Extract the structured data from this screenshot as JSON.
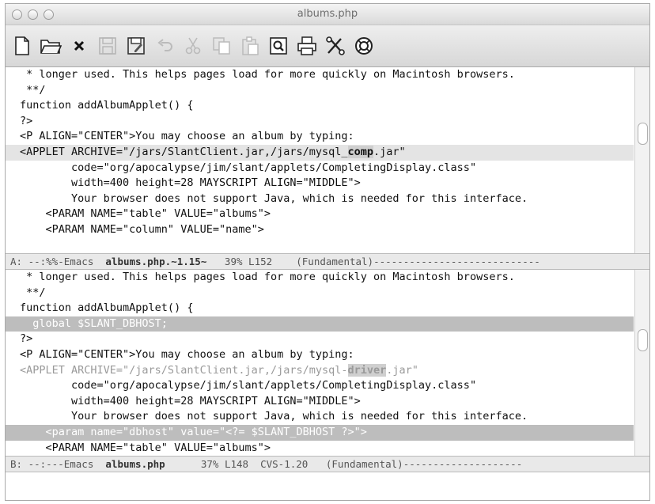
{
  "window": {
    "title": "albums.php"
  },
  "toolbar": {
    "items": [
      {
        "name": "new-file-button",
        "icon": "new-file-icon"
      },
      {
        "name": "open-folder-button",
        "icon": "folder-icon"
      },
      {
        "name": "close-buffer-button",
        "icon": "close-icon"
      },
      {
        "name": "save-button",
        "icon": "save-icon",
        "disabled": true
      },
      {
        "name": "save-as-button",
        "icon": "save-as-icon"
      },
      {
        "name": "undo-button",
        "icon": "undo-icon",
        "disabled": true
      },
      {
        "name": "cut-button",
        "icon": "cut-icon",
        "disabled": true
      },
      {
        "name": "copy-button",
        "icon": "copy-icon",
        "disabled": true
      },
      {
        "name": "paste-button",
        "icon": "paste-icon",
        "disabled": true
      },
      {
        "name": "search-button",
        "icon": "search-icon"
      },
      {
        "name": "print-button",
        "icon": "print-icon"
      },
      {
        "name": "preferences-button",
        "icon": "tools-icon"
      },
      {
        "name": "help-button",
        "icon": "help-icon"
      }
    ]
  },
  "pane_top": {
    "lines": [
      {
        "text": " * longer used. This helps pages load for more quickly on Macintosh browsers."
      },
      {
        "text": " **/"
      },
      {
        "text": "function addAlbumApplet() {"
      },
      {
        "text": "?>"
      },
      {
        "text": "<P ALIGN=\"CENTER\">You may choose an album by typing:"
      },
      {
        "pre": "<APPLET ARCHIVE=\"/jars/SlantClient.jar,/jars/mysql_",
        "mark": "comp",
        "post": ".jar\"",
        "style": "hl"
      },
      {
        "text": "        code=\"org/apocalypse/jim/slant/applets/CompletingDisplay.class\""
      },
      {
        "text": "        width=400 height=28 MAYSCRIPT ALIGN=\"MIDDLE\">"
      },
      {
        "text": "        Your browser does not support Java, which is needed for this interface."
      },
      {
        "text": "    <PARAM NAME=\"table\" VALUE=\"albums\">"
      },
      {
        "text": "    <PARAM NAME=\"column\" VALUE=\"name\">"
      }
    ],
    "modeline": {
      "prefix": "A: --:%%-Emacs  ",
      "buffer": "albums.php.~1.15~",
      "rest": "   39% L152    (Fundamental)----------------------------"
    }
  },
  "pane_bottom": {
    "lines": [
      {
        "text": " * longer used. This helps pages load for more quickly on Macintosh browsers."
      },
      {
        "text": " **/"
      },
      {
        "text": "function addAlbumApplet() {"
      },
      {
        "text": "  global $SLANT_DBHOST;",
        "style": "hl-dark"
      },
      {
        "text": "?>"
      },
      {
        "text": "<P ALIGN=\"CENTER\">You may choose an album by typing:"
      },
      {
        "pre": "<APPLET ARCHIVE=\"/jars/SlantClient.jar,/jars/mysql-",
        "mark": "driver",
        "post": ".jar\"",
        "style": "dim"
      },
      {
        "text": "        code=\"org/apocalypse/jim/slant/applets/CompletingDisplay.class\""
      },
      {
        "text": "        width=400 height=28 MAYSCRIPT ALIGN=\"MIDDLE\">"
      },
      {
        "text": "        Your browser does not support Java, which is needed for this interface."
      },
      {
        "text": "    <param name=\"dbhost\" value=\"<?= $SLANT_DBHOST ?>\">",
        "style": "hl-dark"
      },
      {
        "text": "    <PARAM NAME=\"table\" VALUE=\"albums\">"
      }
    ],
    "modeline": {
      "prefix": "B: --:---Emacs  ",
      "buffer": "albums.php",
      "rest": "      37% L148  CVS-1.20   (Fundamental)--------------------"
    }
  }
}
